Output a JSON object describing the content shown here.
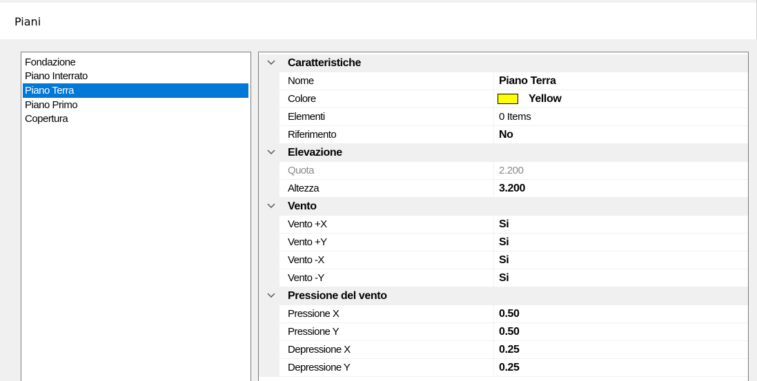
{
  "window": {
    "title": "Piani"
  },
  "floors": {
    "items": [
      {
        "label": "Fondazione",
        "selected": false
      },
      {
        "label": "Piano Interrato",
        "selected": false
      },
      {
        "label": "Piano Terra",
        "selected": true
      },
      {
        "label": "Piano Primo",
        "selected": false
      },
      {
        "label": "Copertura",
        "selected": false
      }
    ]
  },
  "colors": {
    "selection": "#0078d7",
    "category_bg": "#f0f0f0",
    "swatch_yellow": "#ffff00",
    "disabled_text": "#8a8a8a"
  },
  "properties": {
    "caratteristiche": {
      "label": "Caratteristiche",
      "nome": {
        "name": "Nome",
        "value": "Piano Terra"
      },
      "colore": {
        "name": "Colore",
        "value": "Yellow"
      },
      "elementi": {
        "name": "Elementi",
        "value": "0 Items"
      },
      "riferimento": {
        "name": "Riferimento",
        "value": "No"
      }
    },
    "elevazione": {
      "label": "Elevazione",
      "quota": {
        "name": "Quota",
        "value": "2.200"
      },
      "altezza": {
        "name": "Altezza",
        "value": "3.200"
      }
    },
    "vento": {
      "label": "Vento",
      "vx_pos": {
        "name": "Vento +X",
        "value": "Si"
      },
      "vy_pos": {
        "name": "Vento +Y",
        "value": "Si"
      },
      "vx_neg": {
        "name": "Vento -X",
        "value": "Si"
      },
      "vy_neg": {
        "name": "Vento -Y",
        "value": "Si"
      }
    },
    "pressione": {
      "label": "Pressione del vento",
      "px": {
        "name": "Pressione X",
        "value": "0.50"
      },
      "py": {
        "name": "Pressione Y",
        "value": "0.50"
      },
      "dx": {
        "name": "Depressione X",
        "value": "0.25"
      },
      "dy": {
        "name": "Depressione Y",
        "value": "0.25"
      }
    }
  }
}
